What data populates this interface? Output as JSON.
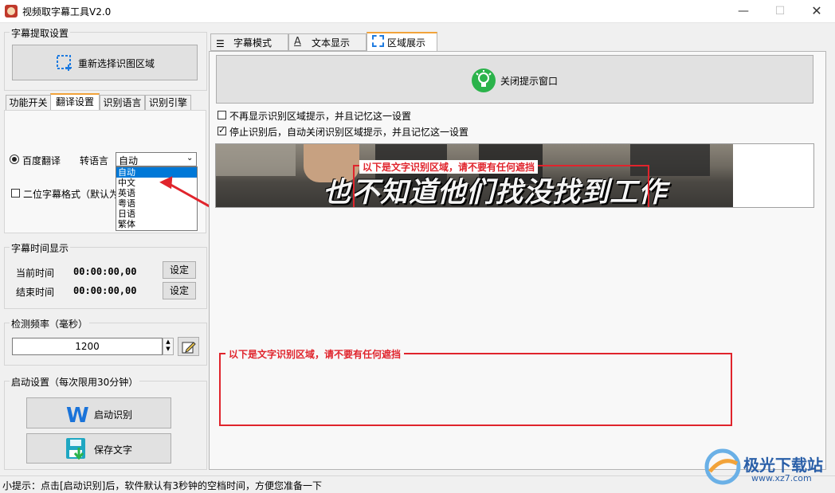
{
  "window": {
    "title": "视频取字幕工具V2.0"
  },
  "extract_group": {
    "title": "字幕提取设置",
    "reselect_label": "重新选择识图区域"
  },
  "left_tabs": [
    "功能开关",
    "翻译设置",
    "识别语言",
    "识别引擎"
  ],
  "translate": {
    "baidu_label": "百度翻译",
    "target_label": "转语言",
    "selected": "自动",
    "options": [
      "自动",
      "中文",
      "英语",
      "粤语",
      "日语",
      "繁体"
    ],
    "bilingual_label": "二位字幕格式（默认为"
  },
  "time_group": {
    "title": "字幕时间显示",
    "current_label": "当前时间",
    "current_value": "00:00:00,00",
    "end_label": "结束时间",
    "end_value": "00:00:00,00",
    "set_label": "设定"
  },
  "freq_group": {
    "title": "检测频率（毫秒）",
    "value": "1200"
  },
  "start_group": {
    "title": "启动设置（每次限用30分钟）",
    "start_label": "启动识别",
    "save_label": "保存文字"
  },
  "right_tabs": [
    "字幕模式",
    "文本显示",
    "区域展示"
  ],
  "region": {
    "close_tip_label": "关闭提示窗口",
    "cb1_label": "不再显示识别区域提示，并且记忆这一设置",
    "cb2_label": "停止识别后，自动关闭识别区域提示，并且记忆这一设置",
    "preview_subtitle": "也不知道他们找没找到工作",
    "overlay_label": "以下是文字识别区域，请不要有任何遮挡"
  },
  "status": {
    "text": "小提示：点击[启动识别]后，软件默认有3秒钟的空档时间，方便您准备一下"
  },
  "watermark": {
    "brand": "极光下载站",
    "url": "www.xz7.com"
  },
  "colors": {
    "accent": "#0078d7",
    "overlay_red": "#e0242c",
    "bulb_green": "#2bb34b"
  }
}
